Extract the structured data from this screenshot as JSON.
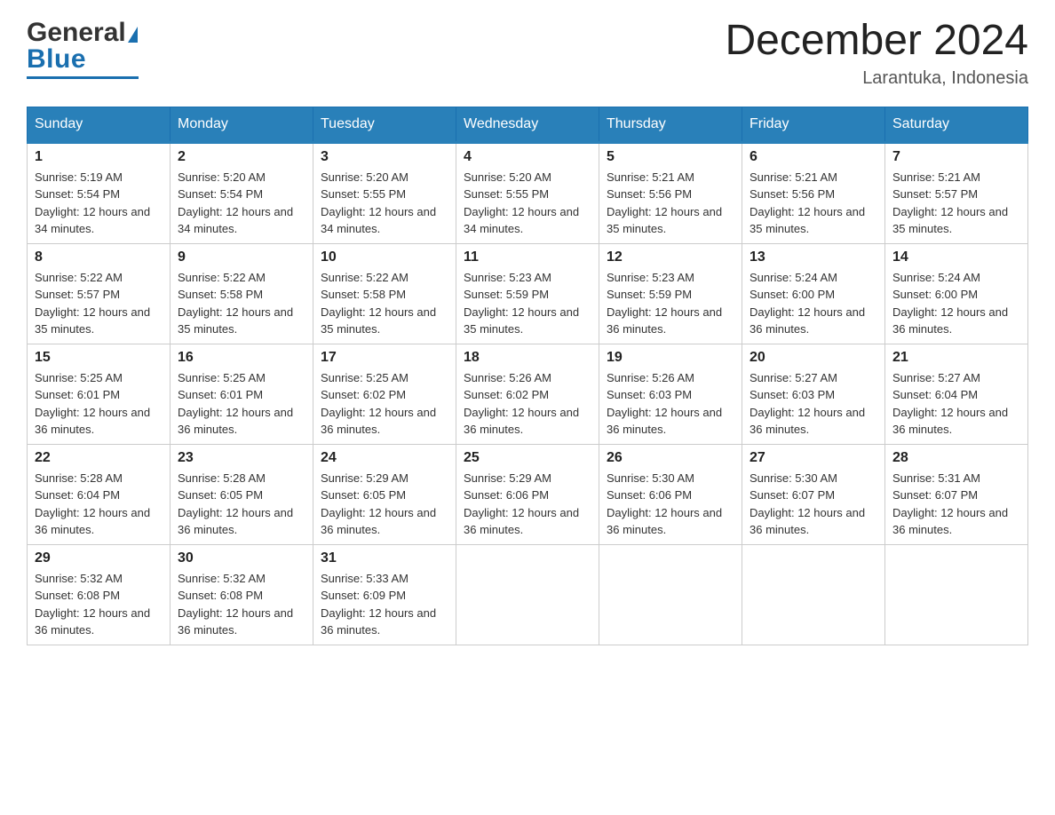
{
  "brand": {
    "name_general": "General",
    "name_blue": "Blue"
  },
  "title": "December 2024",
  "subtitle": "Larantuka, Indonesia",
  "days_header": [
    "Sunday",
    "Monday",
    "Tuesday",
    "Wednesday",
    "Thursday",
    "Friday",
    "Saturday"
  ],
  "weeks": [
    [
      {
        "num": "1",
        "sunrise": "5:19 AM",
        "sunset": "5:54 PM",
        "daylight": "12 hours and 34 minutes."
      },
      {
        "num": "2",
        "sunrise": "5:20 AM",
        "sunset": "5:54 PM",
        "daylight": "12 hours and 34 minutes."
      },
      {
        "num": "3",
        "sunrise": "5:20 AM",
        "sunset": "5:55 PM",
        "daylight": "12 hours and 34 minutes."
      },
      {
        "num": "4",
        "sunrise": "5:20 AM",
        "sunset": "5:55 PM",
        "daylight": "12 hours and 34 minutes."
      },
      {
        "num": "5",
        "sunrise": "5:21 AM",
        "sunset": "5:56 PM",
        "daylight": "12 hours and 35 minutes."
      },
      {
        "num": "6",
        "sunrise": "5:21 AM",
        "sunset": "5:56 PM",
        "daylight": "12 hours and 35 minutes."
      },
      {
        "num": "7",
        "sunrise": "5:21 AM",
        "sunset": "5:57 PM",
        "daylight": "12 hours and 35 minutes."
      }
    ],
    [
      {
        "num": "8",
        "sunrise": "5:22 AM",
        "sunset": "5:57 PM",
        "daylight": "12 hours and 35 minutes."
      },
      {
        "num": "9",
        "sunrise": "5:22 AM",
        "sunset": "5:58 PM",
        "daylight": "12 hours and 35 minutes."
      },
      {
        "num": "10",
        "sunrise": "5:22 AM",
        "sunset": "5:58 PM",
        "daylight": "12 hours and 35 minutes."
      },
      {
        "num": "11",
        "sunrise": "5:23 AM",
        "sunset": "5:59 PM",
        "daylight": "12 hours and 35 minutes."
      },
      {
        "num": "12",
        "sunrise": "5:23 AM",
        "sunset": "5:59 PM",
        "daylight": "12 hours and 36 minutes."
      },
      {
        "num": "13",
        "sunrise": "5:24 AM",
        "sunset": "6:00 PM",
        "daylight": "12 hours and 36 minutes."
      },
      {
        "num": "14",
        "sunrise": "5:24 AM",
        "sunset": "6:00 PM",
        "daylight": "12 hours and 36 minutes."
      }
    ],
    [
      {
        "num": "15",
        "sunrise": "5:25 AM",
        "sunset": "6:01 PM",
        "daylight": "12 hours and 36 minutes."
      },
      {
        "num": "16",
        "sunrise": "5:25 AM",
        "sunset": "6:01 PM",
        "daylight": "12 hours and 36 minutes."
      },
      {
        "num": "17",
        "sunrise": "5:25 AM",
        "sunset": "6:02 PM",
        "daylight": "12 hours and 36 minutes."
      },
      {
        "num": "18",
        "sunrise": "5:26 AM",
        "sunset": "6:02 PM",
        "daylight": "12 hours and 36 minutes."
      },
      {
        "num": "19",
        "sunrise": "5:26 AM",
        "sunset": "6:03 PM",
        "daylight": "12 hours and 36 minutes."
      },
      {
        "num": "20",
        "sunrise": "5:27 AM",
        "sunset": "6:03 PM",
        "daylight": "12 hours and 36 minutes."
      },
      {
        "num": "21",
        "sunrise": "5:27 AM",
        "sunset": "6:04 PM",
        "daylight": "12 hours and 36 minutes."
      }
    ],
    [
      {
        "num": "22",
        "sunrise": "5:28 AM",
        "sunset": "6:04 PM",
        "daylight": "12 hours and 36 minutes."
      },
      {
        "num": "23",
        "sunrise": "5:28 AM",
        "sunset": "6:05 PM",
        "daylight": "12 hours and 36 minutes."
      },
      {
        "num": "24",
        "sunrise": "5:29 AM",
        "sunset": "6:05 PM",
        "daylight": "12 hours and 36 minutes."
      },
      {
        "num": "25",
        "sunrise": "5:29 AM",
        "sunset": "6:06 PM",
        "daylight": "12 hours and 36 minutes."
      },
      {
        "num": "26",
        "sunrise": "5:30 AM",
        "sunset": "6:06 PM",
        "daylight": "12 hours and 36 minutes."
      },
      {
        "num": "27",
        "sunrise": "5:30 AM",
        "sunset": "6:07 PM",
        "daylight": "12 hours and 36 minutes."
      },
      {
        "num": "28",
        "sunrise": "5:31 AM",
        "sunset": "6:07 PM",
        "daylight": "12 hours and 36 minutes."
      }
    ],
    [
      {
        "num": "29",
        "sunrise": "5:32 AM",
        "sunset": "6:08 PM",
        "daylight": "12 hours and 36 minutes."
      },
      {
        "num": "30",
        "sunrise": "5:32 AM",
        "sunset": "6:08 PM",
        "daylight": "12 hours and 36 minutes."
      },
      {
        "num": "31",
        "sunrise": "5:33 AM",
        "sunset": "6:09 PM",
        "daylight": "12 hours and 36 minutes."
      },
      null,
      null,
      null,
      null
    ]
  ],
  "labels": {
    "sunrise": "Sunrise: ",
    "sunset": "Sunset: ",
    "daylight": "Daylight: "
  }
}
